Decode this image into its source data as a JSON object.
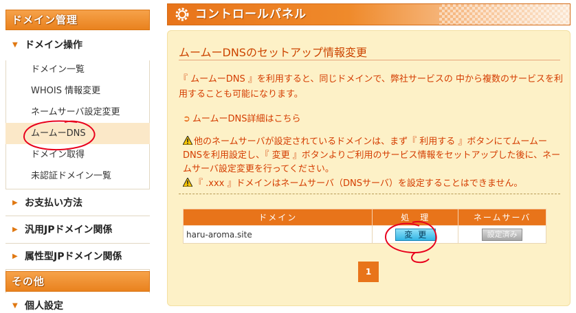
{
  "sidebar": {
    "domain_header": "ドメイン管理",
    "domain_ops_label": "ドメイン操作",
    "items": [
      {
        "label": "ドメイン一覧"
      },
      {
        "label": "WHOIS 情報変更"
      },
      {
        "label": "ネームサーバ設定変更"
      },
      {
        "label": "ムームーDNS"
      },
      {
        "label": "ドメイン取得"
      },
      {
        "label": "未認証ドメイン一覧"
      }
    ],
    "sections": [
      {
        "label": "お支払い方法"
      },
      {
        "label": "汎用JPドメイン関係"
      },
      {
        "label": "属性型JPドメイン関係"
      }
    ],
    "other_header": "その他",
    "personal_label": "個人設定"
  },
  "control_panel_title": "コントロールパネル",
  "main": {
    "heading": "ムームーDNSのセットアップ情報変更",
    "description": "『 ムームーDNS 』を利用すると、同じドメインで、弊社サービスの 中から複数のサービスを利用することも可能になります。",
    "details_link": "ムームーDNS詳細はこちら",
    "warning1": "他のネームサーバが設定されているドメインは、まず『 利用する 』ボタンにてムームーDNSを利用設定し、『 変更 』ボタンよりご利用のサービス情報をセットアップした後に、ネームサーバ設定変更を行ってください。",
    "warning2": "『 .xxx 』ドメインはネームサーバ（DNSサーバ）を設定することはできません。"
  },
  "table": {
    "headers": {
      "domain": "ドメイン",
      "action": "処　理",
      "nameserver": "ネームサーバ"
    },
    "rows": [
      {
        "domain": "haru-aroma.site",
        "action_label": "変更",
        "nameserver_label": "設定済み"
      }
    ]
  },
  "pagination": {
    "current_page": "1"
  },
  "colors": {
    "accent": "#e8741a",
    "panel_bg": "#fdf1c7",
    "text_red": "#d43c00",
    "annotation": "#e8001c"
  }
}
